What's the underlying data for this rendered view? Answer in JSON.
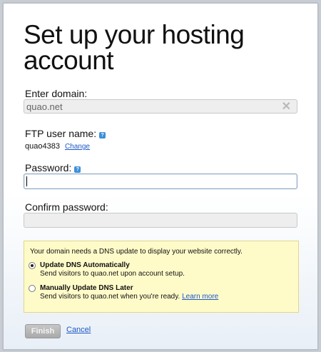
{
  "page": {
    "title": "Set up your hosting account"
  },
  "domain": {
    "label": "Enter domain:",
    "value": "quao.net",
    "clear_icon": "clear-x-icon"
  },
  "ftp": {
    "label": "FTP user name:",
    "value": "quao4383",
    "change_link": "Change",
    "help_icon": "help-icon"
  },
  "password": {
    "label": "Password:",
    "value": "",
    "help_icon": "help-icon"
  },
  "confirm_password": {
    "label": "Confirm password:",
    "value": ""
  },
  "dns": {
    "message": "Your domain needs a DNS update to display your website correctly.",
    "options": [
      {
        "title": "Update DNS Automatically",
        "description": "Send visitors to quao.net upon account setup.",
        "selected": true
      },
      {
        "title": "Manually Update DNS Later",
        "description": "Send visitors to quao.net when you're ready.",
        "learn_more": "Learn more",
        "selected": false
      }
    ]
  },
  "actions": {
    "finish_label": "Finish",
    "cancel_label": "Cancel"
  },
  "colors": {
    "link": "#1b56c7",
    "dns_box_bg": "#fffbc9",
    "help_icon": "#3e8fd8"
  }
}
